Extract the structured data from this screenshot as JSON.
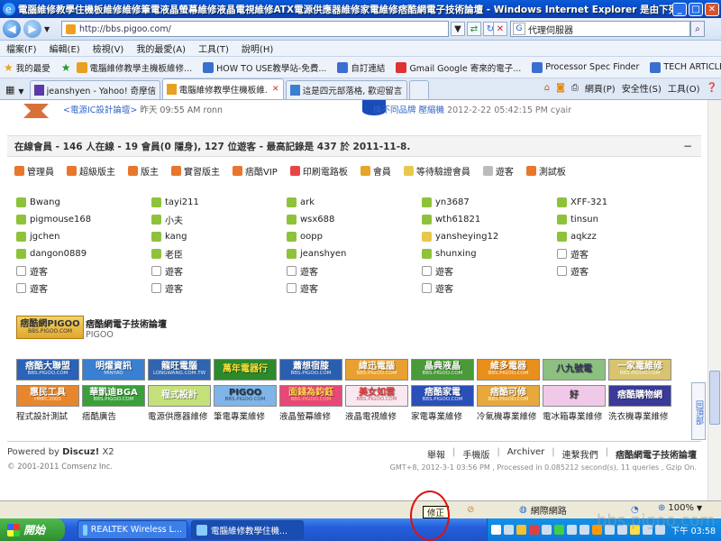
{
  "window": {
    "title": "電腦維修教學住機板維修維修筆電液晶螢幕維修液晶電視維修ATX電源供應器維修家電維修痞酷網電子技術論壇 - Windows Internet Explorer 是由下列提供："
  },
  "address": {
    "url": "http://bbs.pigoo.com/",
    "search_placeholder": "代理伺服器"
  },
  "menu": [
    "檔案(F)",
    "編輯(E)",
    "檢視(V)",
    "我的最愛(A)",
    "工具(T)",
    "說明(H)"
  ],
  "favorites": {
    "label": "我的最愛",
    "items": [
      {
        "label": "電腦維修教學主機板維修...",
        "color": "#e8a020"
      },
      {
        "label": "HOW TO USE教學站-免費...",
        "color": "#3a6fcf"
      },
      {
        "label": "自訂連結",
        "color": "#3a6fcf"
      },
      {
        "label": "Gmail Google 寄來的電子...",
        "color": "#d33"
      },
      {
        "label": "Processor Spec Finder",
        "color": "#3a6fcf"
      },
      {
        "label": "TECH ARTICLES",
        "color": "#3a6fcf"
      }
    ]
  },
  "tabs": [
    {
      "label": "jeanshyen - Yahoo! 奇摩信箱",
      "active": false
    },
    {
      "label": "電腦維修教學住機板維...",
      "active": true
    },
    {
      "label": "這是四元部落格, 歡迎留言...",
      "active": false
    }
  ],
  "toolbar_right": [
    "網頁(P)",
    "安全性(S)",
    "工具(O)"
  ],
  "top_row": {
    "left_link": "<電源IC設計論壇>",
    "left_meta": "昨天 09:55 AM ronn",
    "right_link": "換不同品牌 壓縮機",
    "right_meta": "2012-2-22 05:42:15 PM cyair"
  },
  "online": {
    "header": "在線會員 - 146 人在線 - 19 會員(0 隱身), 127 位遊客 - 最高記錄是 437 於 2011-11-8.",
    "legend": [
      {
        "label": "管理員",
        "color": "#e8762c"
      },
      {
        "label": "超級版主",
        "color": "#e8762c"
      },
      {
        "label": "版主",
        "color": "#e8762c"
      },
      {
        "label": "實習版主",
        "color": "#e8762c"
      },
      {
        "label": "痞酷VIP",
        "color": "#e8762c"
      },
      {
        "label": "印刷電路板",
        "color": "#e84545"
      },
      {
        "label": "會員",
        "color": "#e8a52c"
      },
      {
        "label": "等待驗證會員",
        "color": "#e8c84c"
      },
      {
        "label": "遊客",
        "color": "#bbbbbb"
      },
      {
        "label": "測試板",
        "color": "#e8762c"
      }
    ],
    "users": [
      [
        "Bwang",
        "tayi211",
        "ark",
        "yn3687",
        "XFF-321"
      ],
      [
        "pigmouse168",
        "小夫",
        "wsx688",
        "wth61821",
        "tinsun"
      ],
      [
        "jgchen",
        "kang",
        "oopp",
        "yansheying12",
        "aqkzz"
      ],
      [
        "dangon0889",
        "老臣",
        "jeanshyen",
        "shunxing",
        "遊客"
      ],
      [
        "遊客",
        "遊客",
        "遊客",
        "遊客",
        "遊客"
      ],
      [
        "遊客",
        "遊客",
        "遊客",
        "遊客",
        ""
      ]
    ],
    "user_kinds": [
      [
        "m",
        "m",
        "m",
        "m",
        "m"
      ],
      [
        "m",
        "m",
        "m",
        "m",
        "m"
      ],
      [
        "m",
        "m",
        "m",
        "y",
        "m"
      ],
      [
        "m",
        "m",
        "m",
        "m",
        "g"
      ],
      [
        "g",
        "g",
        "g",
        "g",
        "g"
      ],
      [
        "g",
        "g",
        "g",
        "g",
        ""
      ]
    ]
  },
  "pigoo": {
    "box": "痞酷網PIGOO",
    "box_sub": "BBS.PIGOO.COM",
    "name": "痞酷網電子技術論壇",
    "sub": "PIGOO"
  },
  "banners_row1": [
    {
      "text": "痞酷大聯盟",
      "sub": "BBS.PIGOO.COM",
      "bg": "#2a63b8",
      "fg": "#fff"
    },
    {
      "text": "明燿資訊",
      "sub": "MINYAO",
      "bg": "#3a7fd0",
      "fg": "#fff"
    },
    {
      "text": "龍旺電腦",
      "sub": "LONGWANG.COM.TW",
      "bg": "#3065b0",
      "fg": "#fff"
    },
    {
      "text": "萬年電器行",
      "sub": "",
      "bg": "#2c8a2c",
      "fg": "#ffde3a"
    },
    {
      "text": "蕭想宿膝",
      "sub": "BBS.PIGOO.COM",
      "bg": "#2a5fb0",
      "fg": "#fff"
    },
    {
      "text": "緯迅電腦",
      "sub": "BBS.PIGOO.COM",
      "bg": "#e8a030",
      "fg": "#fff"
    },
    {
      "text": "晶典液晶",
      "sub": "BBS.PIGOO.COM",
      "bg": "#4a9a3a",
      "fg": "#fff"
    },
    {
      "text": "維多電器",
      "sub": "BBS.PIGOO.COM",
      "bg": "#e88f1c",
      "fg": "#fff"
    },
    {
      "text": "八九號電",
      "sub": "",
      "bg": "#8cc080",
      "fg": "#335"
    },
    {
      "text": "一家電維修",
      "sub": "BBS.PIGOO.COM",
      "bg": "#d8c470",
      "fg": "#fff"
    }
  ],
  "banners_row2": [
    {
      "text": "惠民工具",
      "sub": "HMPC2005",
      "bg": "#e8862c",
      "fg": "#fff"
    },
    {
      "text": "華凱迪BGA",
      "sub": "BBS.PIGOO.COM",
      "bg": "#3aa03a",
      "fg": "#fff"
    },
    {
      "text": "程式設計",
      "sub": "",
      "bg": "#c4e07a",
      "fg": "#fff"
    },
    {
      "text": "PIGOO",
      "sub": "BBS.PIGOO.COM",
      "bg": "#7fb5e8",
      "fg": "#234"
    },
    {
      "text": "面錢為鈞鈺",
      "sub": "BBS.PIGOO.COM",
      "bg": "#e84878",
      "fg": "#ffd84a"
    },
    {
      "text": "美女如雲",
      "sub": "BBS.PIGOO.COM",
      "bg": "#f8e8f0",
      "fg": "#d33"
    },
    {
      "text": "痞酷家電",
      "sub": "BBS.PIGOO.COM",
      "bg": "#2a4fb8",
      "fg": "#fff"
    },
    {
      "text": "痞酷可修",
      "sub": "BBS.PIGOO.COM",
      "bg": "#e8a83c",
      "fg": "#fff"
    },
    {
      "text": "好",
      "sub": "",
      "bg": "#f0c8e8",
      "fg": "#333"
    },
    {
      "text": "痞酷購物網",
      "sub": "",
      "bg": "#3a3a9a",
      "fg": "#fff"
    }
  ],
  "banner_labels": [
    "程式設計測試",
    "痞酷廣告",
    "電源供應器維修",
    "筆電專業維修",
    "液晶螢幕維修",
    "液晶電視維修",
    "家電專業維修",
    "冷氣機專業維修",
    "電冰箱專業維修",
    "洗衣機專業維修"
  ],
  "sidebar_tab": "回頂部",
  "footer": {
    "powered": "Powered by",
    "brand": "Discuz!",
    "version": "X2",
    "copyright": "© 2001-2011 Comsenz Inc.",
    "links": [
      "舉報",
      "手機版",
      "Archiver",
      "連繫我們",
      "痞酷網電子技術論壇"
    ],
    "gmt": "GMT+8, 2012-3-1 03:56 PM , Processed in 0.085212 second(s), 11 queries , Gzip On."
  },
  "statusbar": {
    "zone": "網際網路",
    "zoom": "100%",
    "tooltip": "修正"
  },
  "taskbar": {
    "start": "開始",
    "tasks": [
      {
        "label": "REALTEK Wireless L...",
        "active": false
      },
      {
        "label": "電腦維修教學住機...",
        "active": true
      }
    ],
    "clock": "下午 03:58"
  },
  "watermark": "bbs.pigoo.com"
}
